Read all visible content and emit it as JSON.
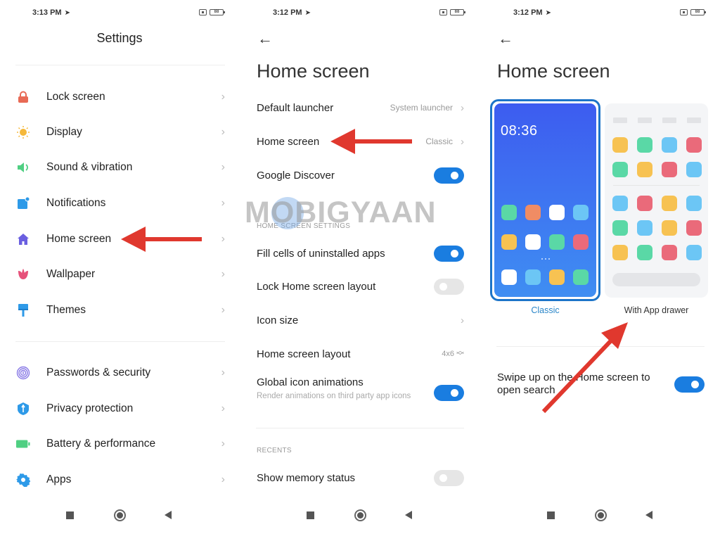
{
  "colors": {
    "accent": "#1a7de0",
    "arrow": "#e0382e",
    "selected_label": "#2a86c8",
    "app_green": "#5ad8a6",
    "app_orange": "#f08c64",
    "app_white": "#ffffff",
    "app_lightblue": "#6cc6f5",
    "app_yellow": "#f7c252",
    "app_red": "#ea6a7a"
  },
  "panel1": {
    "status": {
      "time": "3:13 PM",
      "battery": "88"
    },
    "title": "Settings",
    "items": [
      {
        "label": "Lock screen",
        "icon": "lock-icon"
      },
      {
        "label": "Display",
        "icon": "sun-icon"
      },
      {
        "label": "Sound & vibration",
        "icon": "speaker-icon"
      },
      {
        "label": "Notifications",
        "icon": "notification-icon"
      },
      {
        "label": "Home screen",
        "icon": "home-icon"
      },
      {
        "label": "Wallpaper",
        "icon": "tulip-icon"
      },
      {
        "label": "Themes",
        "icon": "paint-brush-icon"
      },
      {
        "label": "Passwords & security",
        "icon": "fingerprint-icon"
      },
      {
        "label": "Privacy protection",
        "icon": "shield-icon"
      },
      {
        "label": "Battery & performance",
        "icon": "battery-icon"
      },
      {
        "label": "Apps",
        "icon": "gear-icon"
      }
    ]
  },
  "panel2": {
    "status": {
      "time": "3:12 PM",
      "battery": "88"
    },
    "title": "Home screen",
    "default_launcher": {
      "label": "Default launcher",
      "value": "System launcher"
    },
    "home_screen": {
      "label": "Home screen",
      "value": "Classic"
    },
    "google_discover": {
      "label": "Google Discover",
      "enabled": true
    },
    "section_home": "HOME SCREEN SETTINGS",
    "fill_cells": {
      "label": "Fill cells of uninstalled apps",
      "enabled": true
    },
    "lock_layout": {
      "label": "Lock Home screen layout",
      "enabled": false
    },
    "icon_size": {
      "label": "Icon size"
    },
    "layout": {
      "label": "Home screen layout",
      "value": "4x6"
    },
    "icon_animations": {
      "label": "Global icon animations",
      "sublabel": "Render animations on third party app icons",
      "enabled": true
    },
    "section_recents": "RECENTS",
    "memory_status": {
      "label": "Show memory status",
      "enabled": false
    }
  },
  "panel3": {
    "status": {
      "time": "3:12 PM",
      "battery": "88"
    },
    "title": "Home screen",
    "classic": {
      "label": "Classic",
      "clock": "08:36",
      "selected": true
    },
    "drawer": {
      "label": "With App drawer",
      "selected": false
    },
    "swipe_search": {
      "label": "Swipe up on the Home screen to open search",
      "enabled": true
    }
  },
  "watermark": "MOBIGYAAN"
}
